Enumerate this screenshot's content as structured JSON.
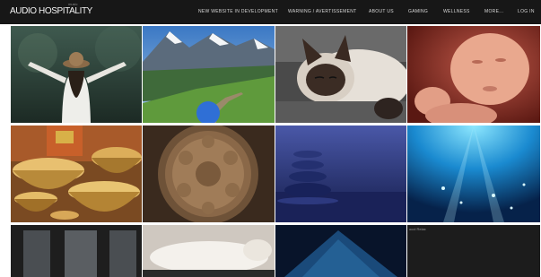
{
  "header": {
    "logo": "AUDIO HOSPITALITY",
    "logo_sub": "music",
    "nav": [
      "NEW WEBSITE IN DEVELOPMENT",
      "WARNING / AVERTISSEMENT",
      "ABOUT US",
      "GAMING",
      "WELLNESS",
      "MORE...",
      "LOG IN"
    ]
  },
  "tiles": {
    "t8": {
      "caption": "ocol Relax"
    }
  },
  "colors": {
    "topbar": "#171717",
    "background": "#ffffff",
    "nav_text": "#d8d8d8"
  }
}
